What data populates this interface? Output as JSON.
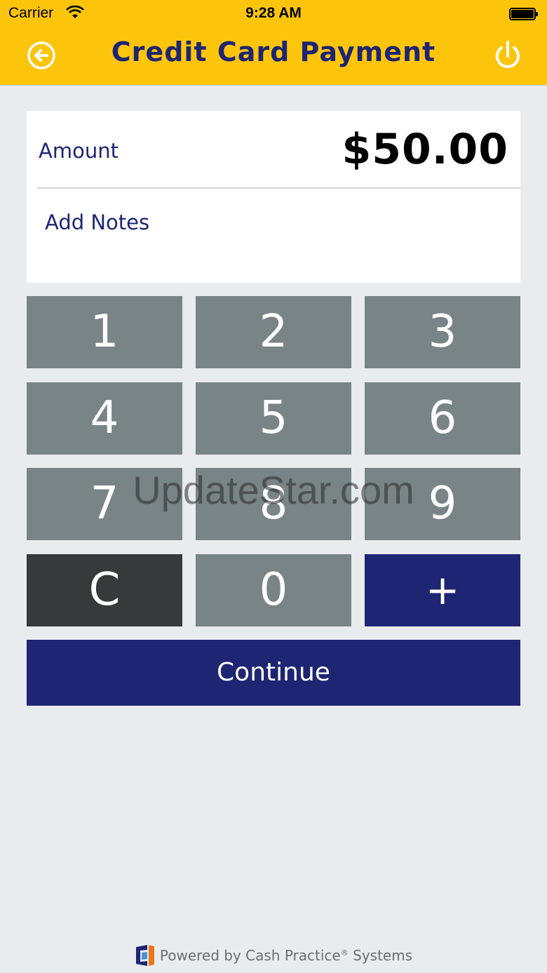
{
  "status_bar": {
    "carrier": "Carrier",
    "time": "9:28 AM"
  },
  "nav": {
    "title": "Credit Card Payment",
    "back_icon": "back-arrow-circle-icon",
    "power_icon": "power-icon"
  },
  "payment": {
    "amount_label": "Amount",
    "amount_value": "$50.00",
    "notes_placeholder": "Add Notes"
  },
  "keypad": {
    "keys": [
      "1",
      "2",
      "3",
      "4",
      "5",
      "6",
      "7",
      "8",
      "9",
      "C",
      "0",
      "+"
    ]
  },
  "actions": {
    "continue_label": "Continue"
  },
  "watermark": "UpdateStar.com",
  "footer": {
    "powered_by": "Powered by Cash Practice",
    "registered": "®",
    "systems": " Systems"
  },
  "colors": {
    "header_yellow": "#fcc50b",
    "navy": "#1e2573",
    "key_gray": "#798486",
    "key_dark": "#363a3b",
    "background": "#e8ecee"
  }
}
